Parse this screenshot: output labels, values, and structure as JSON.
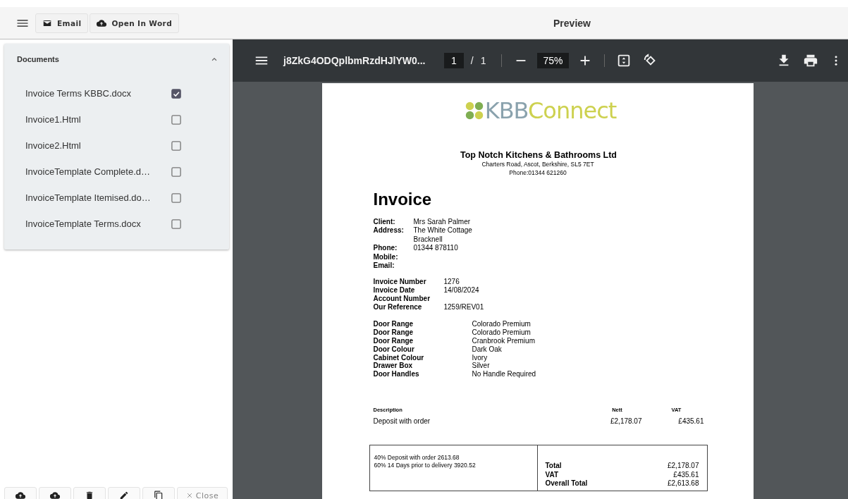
{
  "app_bar": {
    "buttons": [
      {
        "kind": "email",
        "label": "Email"
      },
      {
        "kind": "word",
        "label": "Open In Word"
      }
    ],
    "title": "Preview"
  },
  "documents": {
    "title": "Documents",
    "expanded": true,
    "items": [
      {
        "name": "Invoice Terms KBBC.docx",
        "checked": true
      },
      {
        "name": "Invoice1.Html",
        "checked": false
      },
      {
        "name": "Invoice2.Html",
        "checked": false
      },
      {
        "name": "InvoiceTemplate Complete.d…",
        "checked": false
      },
      {
        "name": "InvoiceTemplate Itemised.do…",
        "checked": false
      },
      {
        "name": "InvoiceTemplate Terms.docx",
        "checked": false
      }
    ]
  },
  "actions": [
    {
      "kind": "upload"
    },
    {
      "kind": "upload"
    },
    {
      "kind": "delete"
    },
    {
      "kind": "edit"
    },
    {
      "kind": "copy"
    },
    {
      "kind": "close",
      "label": "Close"
    }
  ],
  "viewer": {
    "file_name": "j8ZkG4ODQplbmRzdHJlYW0...",
    "page": "1",
    "page_separator": "/",
    "page_count": "1",
    "zoom": "75%"
  },
  "invoice": {
    "logo": {
      "part_1": "KBB",
      "part_2": "Connect"
    },
    "company": "Top Notch Kitchens & Bathrooms Ltd",
    "address": "Charters Road, Ascot, Berkshire, SL5 7ET",
    "phone": "Phone:01344 621260",
    "heading": "Invoice",
    "client_fields": [
      {
        "label": "Client:",
        "values": [
          "Mrs Sarah Palmer"
        ]
      },
      {
        "label": "Address:",
        "values": [
          "The White Cottage",
          "Bracknell"
        ]
      },
      {
        "label": "Phone:",
        "values": [
          "01344 878110"
        ]
      },
      {
        "label": "Mobile:"
      },
      {
        "label": "Email:"
      }
    ],
    "invoice_fields": [
      {
        "label": "Invoice Number",
        "value": "1276"
      },
      {
        "label": "Invoice Date",
        "value": "14/08/2024"
      },
      {
        "label": "Account Number"
      },
      {
        "label": "Our Reference",
        "value": "1259/REV01"
      }
    ],
    "product_fields": [
      {
        "label": "Door Range",
        "value": "Colorado Premium"
      },
      {
        "label": "Door Range",
        "value": "Colorado Premium"
      },
      {
        "label": "Door Range",
        "value": "Cranbrook Premium"
      },
      {
        "label": "Door Colour",
        "value": "Dark Oak"
      },
      {
        "label": "Cabinet Colour",
        "value": "Ivory"
      },
      {
        "label": "Drawer Box",
        "value": "Silver"
      },
      {
        "label": "Door Handles",
        "value": "No Handle Required"
      }
    ],
    "line_items": {
      "columns": [
        "Description",
        "Nett",
        "VAT"
      ],
      "rows": [
        [
          "Deposit with order",
          "£2,178.07",
          "£435.61"
        ]
      ]
    },
    "payment_terms": [
      "40% Deposit with order 2613.68",
      "60% 14 Days prior to delivery 3920.52"
    ],
    "totals": [
      {
        "label": "Total",
        "value": "£2,178.07"
      },
      {
        "label": "VAT",
        "value": "£435.61"
      },
      {
        "label": "Overall Total",
        "value": "£2,613.68"
      }
    ]
  }
}
